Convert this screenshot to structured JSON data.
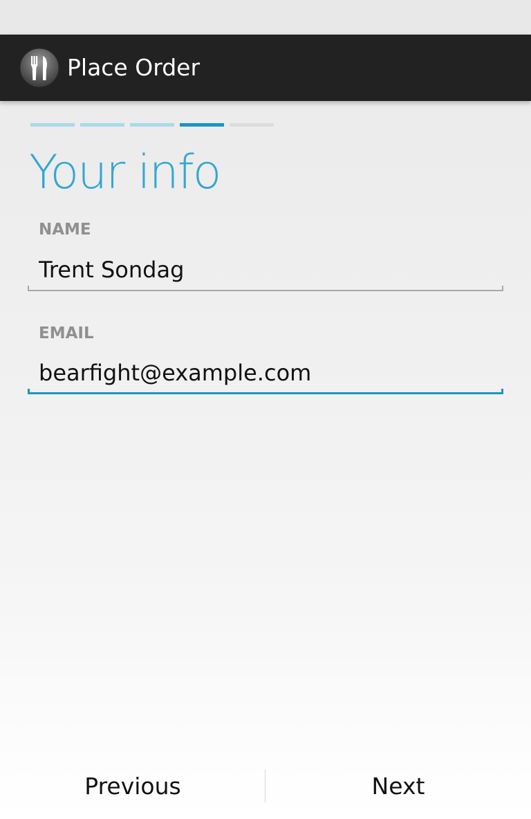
{
  "action_bar": {
    "title": "Place Order",
    "icon": "fork-knife-icon"
  },
  "wizard": {
    "total_steps": 5,
    "current_step": 4,
    "colors": {
      "completed": "#a9d9ea",
      "current": "#1a94c4",
      "upcoming": "#dcdcdc"
    }
  },
  "page": {
    "title": "Your info"
  },
  "form": {
    "name": {
      "label": "NAME",
      "value": "Trent Sondag"
    },
    "email": {
      "label": "EMAIL",
      "value": "bearfight@example.com"
    }
  },
  "navigation": {
    "previous_label": "Previous",
    "next_label": "Next"
  },
  "colors": {
    "accent": "#33a7d2",
    "action_bar": "#222222"
  }
}
